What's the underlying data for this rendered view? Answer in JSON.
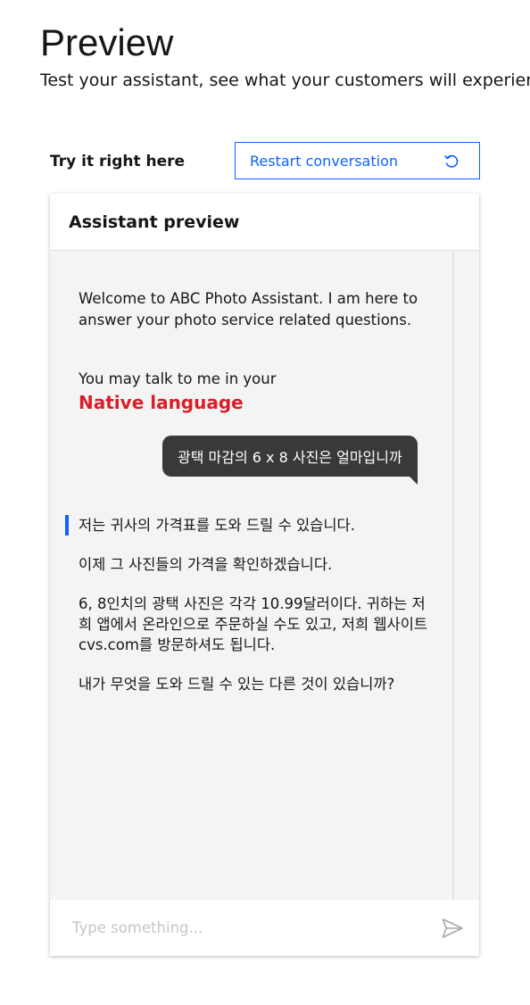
{
  "header": {
    "title": "Preview",
    "subtitle": "Test your assistant, see what your customers will experience"
  },
  "toolbar": {
    "try_label": "Try it right here",
    "restart_label": "Restart conversation",
    "restart_icon": "restart-icon"
  },
  "panel": {
    "title": "Assistant preview"
  },
  "messages": {
    "welcome": "Welcome to ABC Photo Assistant. I am here to answer your photo service related questions.",
    "talk": "You may talk to me in your",
    "native": "Native language",
    "user": "광택 마감의 6 x 8 사진은 얼마입니까",
    "reply": [
      "저는 귀사의 가격표를 도와 드릴 수 있습니다.",
      "이제 그 사진들의 가격을 확인하겠습니다.",
      "6, 8인치의 광택 사진은 각각 10.99달러이다. 귀하는 저희 앱에서 온라인으로 주문하실 수도 있고, 저희 웹사이트 cvs.com를 방문하셔도 됩니다.",
      "내가 무엇을 도와 드릴 수 있는 다른 것이 있습니까?"
    ]
  },
  "composer": {
    "placeholder": "Type something...",
    "send_icon": "send-icon"
  },
  "colors": {
    "accent": "#0f62fe",
    "native_language": "#da1e28",
    "user_bubble": "#393939",
    "panel_bg": "#f4f4f4"
  }
}
